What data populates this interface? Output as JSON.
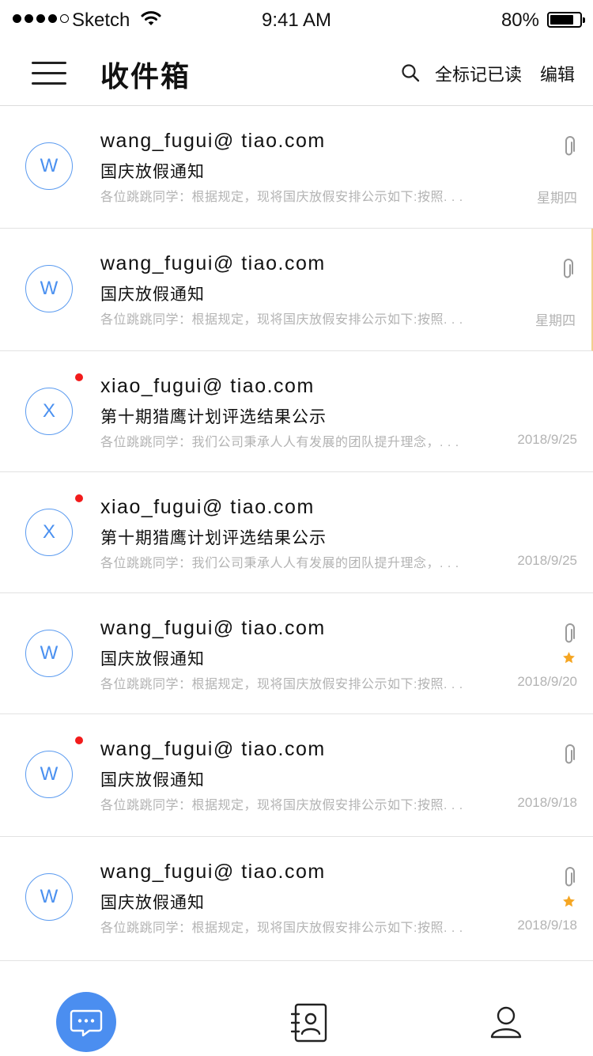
{
  "status_bar": {
    "carrier": "Sketch",
    "time": "9:41 AM",
    "battery": "80%",
    "battery_level": 0.8
  },
  "nav": {
    "title": "收件箱",
    "mark_all_read": "全标记已读",
    "edit": "编辑"
  },
  "mails": [
    {
      "avatar": "W",
      "sender": "wang_fugui@ tiao.com",
      "subject": "国庆放假通知",
      "preview": "各位跳跳同学：根据规定，现将国庆放假安排公示如下:按照. . .",
      "date": "星期四",
      "attachment": true,
      "starred": false,
      "unread": false,
      "highlight": false
    },
    {
      "avatar": "W",
      "sender": "wang_fugui@ tiao.com",
      "subject": "国庆放假通知",
      "preview": "各位跳跳同学：根据规定，现将国庆放假安排公示如下:按照. . .",
      "date": "星期四",
      "attachment": true,
      "starred": false,
      "unread": false,
      "highlight": true
    },
    {
      "avatar": "X",
      "sender": "xiao_fugui@ tiao.com",
      "subject": "第十期猎鹰计划评选结果公示",
      "preview": "各位跳跳同学：我们公司秉承人人有发展的团队提升理念，. . .",
      "date": "2018/9/25",
      "attachment": false,
      "starred": false,
      "unread": true,
      "highlight": false
    },
    {
      "avatar": "X",
      "sender": "xiao_fugui@ tiao.com",
      "subject": "第十期猎鹰计划评选结果公示",
      "preview": "各位跳跳同学：我们公司秉承人人有发展的团队提升理念，. . .",
      "date": "2018/9/25",
      "attachment": false,
      "starred": false,
      "unread": true,
      "highlight": false
    },
    {
      "avatar": "W",
      "sender": "wang_fugui@ tiao.com",
      "subject": "国庆放假通知",
      "preview": "各位跳跳同学：根据规定，现将国庆放假安排公示如下:按照. . .",
      "date": "2018/9/20",
      "attachment": true,
      "starred": true,
      "unread": false,
      "highlight": false
    },
    {
      "avatar": "W",
      "sender": "wang_fugui@ tiao.com",
      "subject": "国庆放假通知",
      "preview": "各位跳跳同学：根据规定，现将国庆放假安排公示如下:按照. . .",
      "date": "2018/9/18",
      "attachment": true,
      "starred": false,
      "unread": true,
      "highlight": false
    },
    {
      "avatar": "W",
      "sender": "wang_fugui@ tiao.com",
      "subject": "国庆放假通知",
      "preview": "各位跳跳同学：根据规定，现将国庆放假安排公示如下:按照. . .",
      "date": "2018/9/18",
      "attachment": true,
      "starred": true,
      "unread": false,
      "highlight": false
    }
  ],
  "tabs": [
    {
      "icon": "chat-bubble-icon",
      "active": true
    },
    {
      "icon": "contacts-book-icon",
      "active": false
    },
    {
      "icon": "user-profile-icon",
      "active": false
    }
  ],
  "colors": {
    "accent": "#4b8ef0",
    "avatar_border": "#5b9bf0",
    "unread_dot": "#f21b1b",
    "star": "#f5a623",
    "muted_text": "#b3b3b3"
  }
}
